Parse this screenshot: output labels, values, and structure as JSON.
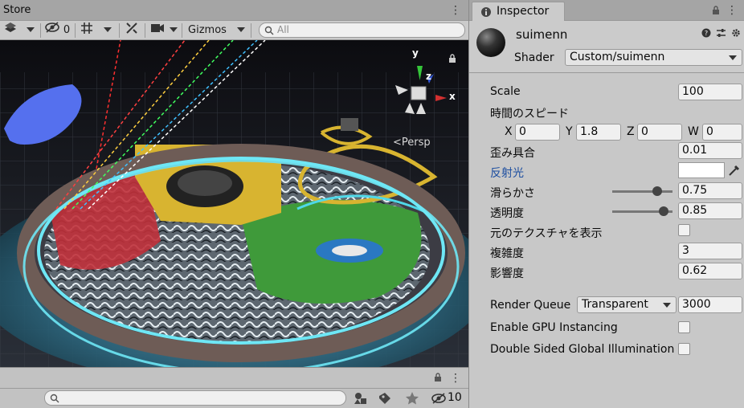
{
  "scene": {
    "tab_title": "Store",
    "toolbar": {
      "hidden_count": "0",
      "gizmos_label": "Gizmos",
      "search_placeholder": "All"
    },
    "persp_label": "Persp",
    "gizmo_axes": {
      "x": "x",
      "y": "y",
      "z": "z"
    }
  },
  "bottom": {
    "search_placeholder": "",
    "visibility_count": "10"
  },
  "inspector": {
    "tab_title": "Inspector",
    "material_name": "suimenn",
    "shader_label": "Shader",
    "shader_value": "Custom/suimenn",
    "properties": {
      "scale": {
        "label": "Scale",
        "value": "100"
      },
      "speed": {
        "label": "時間のスピード",
        "x_label": "X",
        "x": "0",
        "y_label": "Y",
        "y": "1.8",
        "z_label": "Z",
        "z": "0",
        "w_label": "W",
        "w": "0"
      },
      "distortion": {
        "label": "歪み具合",
        "value": "0.01"
      },
      "reflection": {
        "label": "反射光",
        "color": "#ffffff"
      },
      "smoothness": {
        "label": "滑らかさ",
        "value": "0.75",
        "fraction": 0.75
      },
      "transparency": {
        "label": "透明度",
        "value": "0.85",
        "fraction": 0.85
      },
      "show_texture": {
        "label": "元のテクスチャを表示",
        "checked": false
      },
      "complexity": {
        "label": "複雑度",
        "value": "3"
      },
      "shadow": {
        "label": "影響度",
        "value": "0.62"
      }
    },
    "render_queue": {
      "label": "Render Queue",
      "mode": "Transparent",
      "value": "3000"
    },
    "gpu_instancing": {
      "label": "Enable GPU Instancing",
      "checked": false
    },
    "double_sided_gi": {
      "label": "Double Sided Global Illumination",
      "checked": false
    }
  }
}
